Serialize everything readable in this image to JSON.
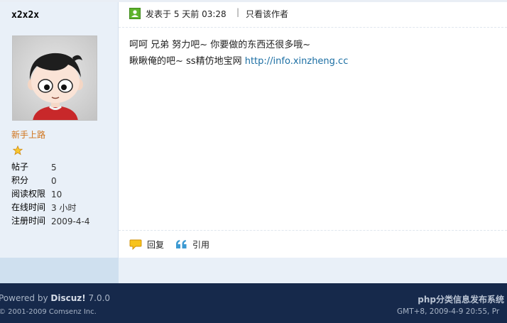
{
  "user": {
    "name": "x2x2x",
    "group": "新手上路",
    "stats": [
      {
        "label": "帖子",
        "value": "5"
      },
      {
        "label": "积分",
        "value": "0"
      },
      {
        "label": "阅读权限",
        "value": "10"
      },
      {
        "label": "在线时间",
        "value": "3 小时"
      },
      {
        "label": "注册时间",
        "value": "2009-4-4"
      }
    ]
  },
  "post": {
    "posted_at": "发表于 5 天前 03:28",
    "separator": "|",
    "only_author": "只看该作者",
    "line1": "呵呵 兄弟 努力吧~ 你要做的东西还很多哦~",
    "line2_text": "瞅瞅俺的吧~ ss精仿地宝网 ",
    "line2_link": "http://info.xinzheng.cc"
  },
  "actions": {
    "reply": "回复",
    "quote": "引用"
  },
  "footer": {
    "powered_prefix": "Powered by ",
    "powered_brand": "Discuz!",
    "powered_version": " 7.0.0",
    "copyright": "© 2001-2009 Comsenz Inc.",
    "site_name": "php分类信息发布系统",
    "gmt": "GMT+8, 2009-4-9 20:55, Pr"
  },
  "colors": {
    "user_group": "#d0731b",
    "link": "#1b6ea3",
    "footer_bg": "#16294b"
  }
}
